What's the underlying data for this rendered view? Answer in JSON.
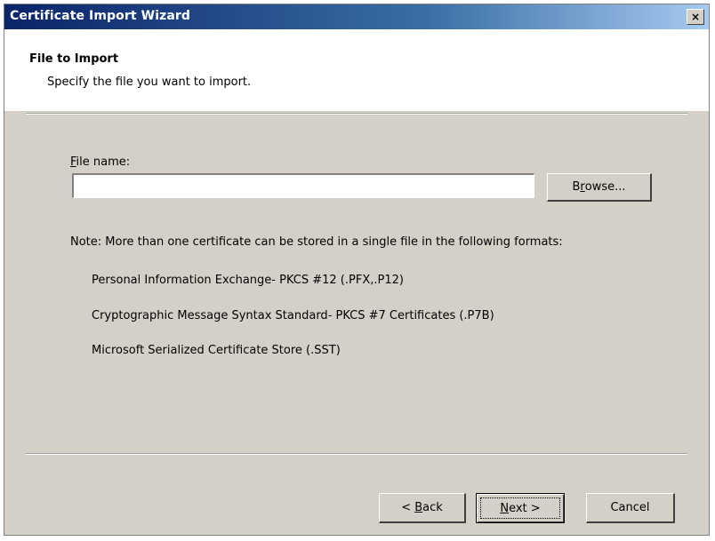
{
  "window": {
    "title": "Certificate Import Wizard",
    "close_glyph": "×"
  },
  "header": {
    "title": "File to Import",
    "subtitle": "Specify the file you want to import."
  },
  "file_field": {
    "label_accel": "F",
    "label_rest": "ile name:",
    "value": "",
    "placeholder": ""
  },
  "browse_button": {
    "label_pre": "B",
    "label_accel": "r",
    "label_post": "owse..."
  },
  "note": "Note:  More than one certificate can be stored in a single file in the following formats:",
  "formats": [
    "Personal Information Exchange- PKCS #12 (.PFX,.P12)",
    "Cryptographic Message Syntax Standard- PKCS #7 Certificates (.P7B)",
    "Microsoft Serialized Certificate Store (.SST)"
  ],
  "buttons": {
    "back_prefix": "< ",
    "back_accel": "B",
    "back_rest": "ack",
    "next_accel": "N",
    "next_rest": "ext >",
    "cancel": "Cancel"
  },
  "colors": {
    "titlebar_start": "#0a246a",
    "titlebar_end": "#a6caf0",
    "dialog_face": "#d4d0c8",
    "header_bg": "#ffffff"
  }
}
